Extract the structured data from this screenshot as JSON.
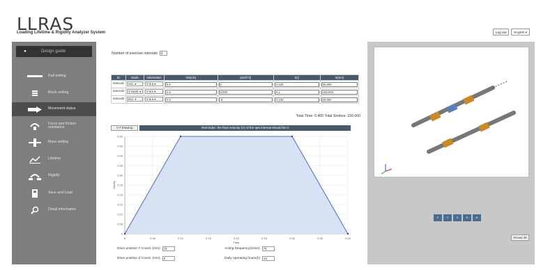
{
  "header": {
    "logo": "LLRAS",
    "subtitle": "Loading Lifetime & Rigidity Analyzer System",
    "logout_label": "Log out",
    "language": "English"
  },
  "sidebar": {
    "guide_label": "Design guide",
    "items": [
      {
        "label": "Rail setting",
        "icon": "rail-icon"
      },
      {
        "label": "Block setting",
        "icon": "block-icon"
      },
      {
        "label": "Movement status",
        "icon": "movement-icon"
      },
      {
        "label": "Force and friction resistance",
        "icon": "force-icon"
      },
      {
        "label": "Mass setting",
        "icon": "mass-icon"
      },
      {
        "label": "Lifetime",
        "icon": "lifetime-icon"
      },
      {
        "label": "Rigidity",
        "icon": "rigidity-icon"
      },
      {
        "label": "Save and Load",
        "icon": "save-icon"
      },
      {
        "label": "Detail information",
        "icon": "search-icon"
      }
    ]
  },
  "main": {
    "intervals_label": "Number of exercise intervals",
    "intervals_value": "3",
    "table": {
      "headers": [
        "ID",
        "Mode",
        "Information",
        "V0(m/s)",
        "a(m/s^2)",
        "t(s)",
        "S(mm)"
      ],
      "rows": [
        {
          "id": "Interval1",
          "mode": "Acc.",
          "info": "V & a",
          "v0": "0.5",
          "a": "5",
          "t": "0.100",
          "s": "25.000"
        },
        {
          "id": "Interval2",
          "mode": "V consl.",
          "info": "V & L",
          "v0": "0.5",
          "a": "0.000",
          "t": "0.2",
          "s": "100.000"
        },
        {
          "id": "Interval3",
          "mode": "Dcc.",
          "info": "V & a",
          "v0": "0.5",
          "a": "-5",
          "t": "0.100",
          "s": "25.000"
        }
      ]
    },
    "totals": "Total Time: 0.400   Total Strokes: 150.000",
    "vt_button": "V-T Drawing",
    "warning": "Reminder: the final velocity (V) of the last interval should be 0",
    "fields": {
      "drive_y_label": "Drive position Y Coord. (mm)",
      "drive_y_value": "75",
      "drive_z_label": "Drive position Z Coord. (mm)",
      "drive_z_value": "0",
      "freq_label": "Acting frequency(1/min)",
      "freq_value": "75",
      "hours_label": "Daily operating hours(h)",
      "hours_value": "24"
    }
  },
  "chart_data": {
    "type": "area",
    "x": [
      0,
      0.1,
      0.3,
      0.4
    ],
    "values": [
      0,
      0.5,
      0.5,
      0
    ],
    "xlabel": "Time",
    "ylabel": "V(m/s)",
    "xlim": [
      0,
      0.4
    ],
    "ylim": [
      0,
      0.5
    ],
    "xticks": [
      "0",
      "0.05",
      "0.10",
      "0.15",
      "0.20",
      "0.25",
      "0.30",
      "0.35",
      "0.40"
    ],
    "yticks": [
      "0",
      "0.05",
      "0.10",
      "0.15",
      "0.20",
      "0.25",
      "0.30",
      "0.35",
      "0.40",
      "0.45",
      "0.50"
    ],
    "grid": true,
    "fill_color": "#d7e2f4",
    "line_color": "#4a6fb5"
  },
  "viewer": {
    "buttons": [
      "F",
      "T",
      "S",
      "R",
      "B"
    ],
    "reload_label": "Reload 3D"
  },
  "colors": {
    "header_bar": "#4b5a6b",
    "sidebar": "#7e7e7e",
    "accent_orange": "#c88a2a",
    "accent_blue": "#5b7fb3"
  }
}
